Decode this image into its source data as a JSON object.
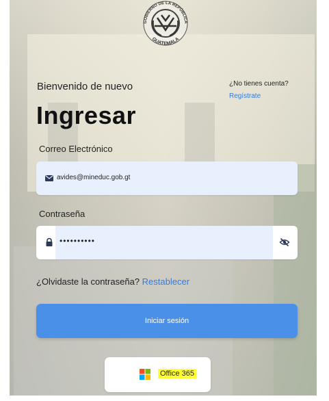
{
  "seal": {
    "top_text": "GOBIERNO DE LA REPÚBLICA",
    "bottom_text": "GUATEMALA"
  },
  "header": {
    "welcome": "Bienvenido de nuevo",
    "no_account": "¿No tienes cuenta?",
    "register_link": "Regístrate",
    "title": "Ingresar"
  },
  "form": {
    "email_label": "Correo Electrónico",
    "email_value": "avides@mineduc.gob.gt",
    "password_label": "Contraseña",
    "password_value": "••••••••••",
    "forgot_text": "¿Olvidaste la contraseña?",
    "restore_link": "Restablecer",
    "submit_label": "Iniciar sesión"
  },
  "office": {
    "label": "Office 365"
  },
  "colors": {
    "accent": "#4a90e8",
    "link": "#2f7be5",
    "field_bg": "#e8f0fe",
    "highlight": "#ffff33"
  },
  "icons": {
    "email": "envelope-icon",
    "password": "lock-icon",
    "toggle_password": "eye-slash-icon",
    "office": "microsoft-logo-icon",
    "seal": "guatemala-seal-icon"
  }
}
